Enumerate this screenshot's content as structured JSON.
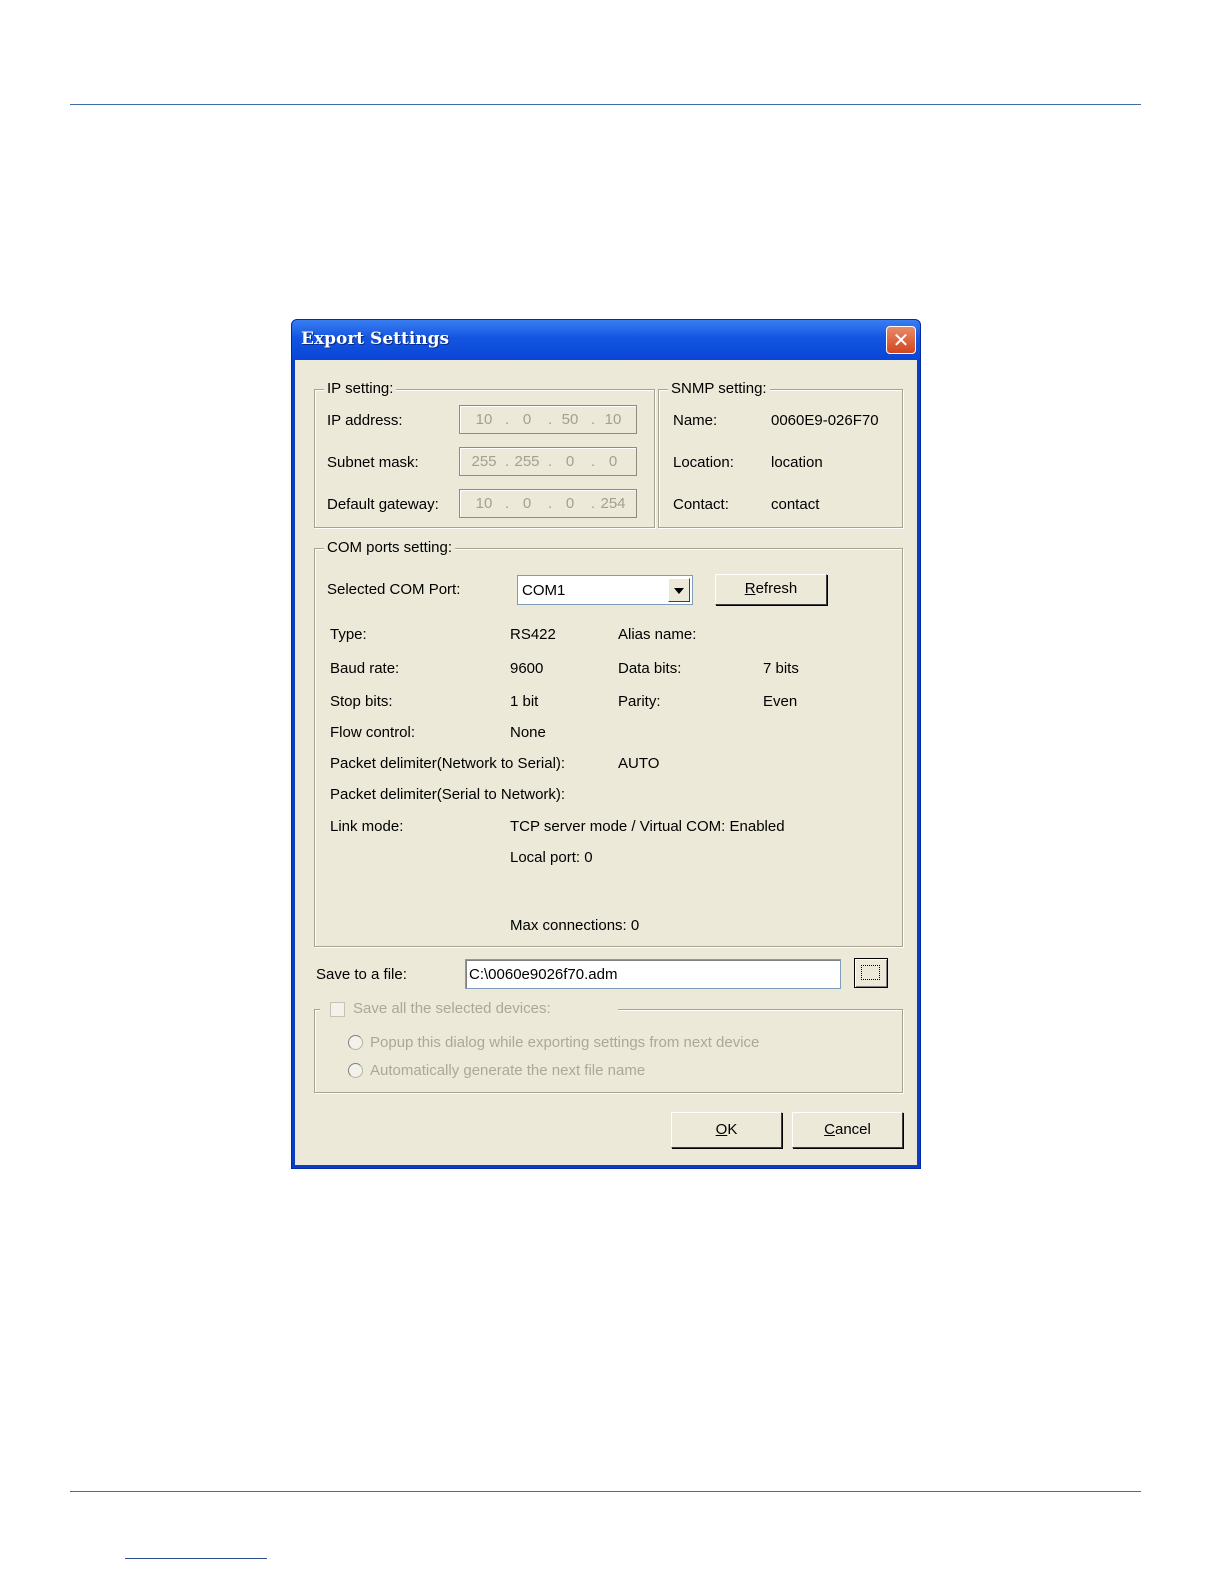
{
  "dialog": {
    "title": "Export Settings",
    "close_glyph": "✕",
    "close_icon": "close-icon",
    "ip_setting": {
      "legend": "IP setting:",
      "fields": [
        {
          "label": "IP address:",
          "octets": [
            "10",
            "0",
            "50",
            "10"
          ]
        },
        {
          "label": "Subnet mask:",
          "octets": [
            "255",
            "255",
            "0",
            "0"
          ]
        },
        {
          "label": "Default gateway:",
          "octets": [
            "10",
            "0",
            "0",
            "254"
          ]
        }
      ]
    },
    "snmp_setting": {
      "legend": "SNMP setting:",
      "rows": [
        {
          "label": "Name:",
          "value": "0060E9-026F70"
        },
        {
          "label": "Location:",
          "value": "location"
        },
        {
          "label": "Contact:",
          "value": "contact"
        }
      ]
    },
    "com_ports": {
      "legend": "COM ports setting:",
      "selected_label": "Selected COM Port:",
      "selected_value": "COM1",
      "refresh_label_prefix": "",
      "refresh_label_underlined": "R",
      "refresh_label_rest": "efresh",
      "type_label": "Type:",
      "type_value": "RS422",
      "alias_label": "Alias name:",
      "baud_label": "Baud rate:",
      "baud_value": "9600",
      "databits_label": "Data bits:",
      "databits_value": "7 bits",
      "stopbits_label": "Stop bits:",
      "stopbits_value": "1 bit",
      "parity_label": "Parity:",
      "parity_value": "Even",
      "flow_label": "Flow control:",
      "flow_value": "None",
      "delim_n2s_label": "Packet delimiter(Network to Serial):",
      "delim_n2s_value": "AUTO",
      "delim_s2n_label": "Packet delimiter(Serial to Network):",
      "link_label": "Link mode:",
      "link_value": "TCP server mode / Virtual COM: Enabled",
      "local_port": "Local port: 0",
      "max_conn": "Max connections: 0"
    },
    "save_file": {
      "label": "Save to a file:",
      "value": "C:\\0060e9026f70.adm",
      "browse_icon": "ellipsis-icon"
    },
    "save_all": {
      "checkbox_label": "Save all the selected devices:",
      "checked": false,
      "options": [
        "Popup this dialog while exporting settings from next device",
        "Automatically generate the next file name"
      ]
    },
    "buttons": {
      "ok_underlined": "O",
      "ok_rest": "K",
      "cancel_underlined": "C",
      "cancel_rest": "ancel"
    }
  }
}
